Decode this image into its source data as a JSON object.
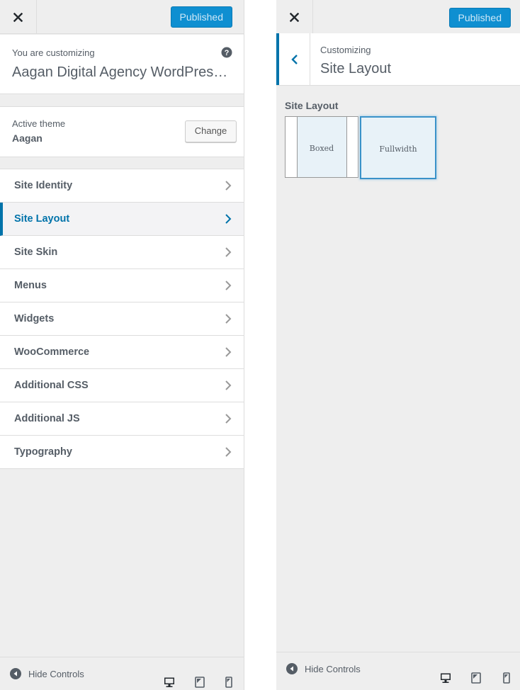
{
  "left": {
    "header": {
      "publish_label": "Published"
    },
    "customizing": {
      "label": "You are customizing",
      "site_title": "Aagan Digital Agency WordPress Theme"
    },
    "theme": {
      "label": "Active theme",
      "name": "Aagan",
      "change_label": "Change"
    },
    "menu": [
      {
        "label": "Site Identity",
        "active": false
      },
      {
        "label": "Site Layout",
        "active": true
      },
      {
        "label": "Site Skin",
        "active": false
      },
      {
        "label": "Menus",
        "active": false
      },
      {
        "label": "Widgets",
        "active": false
      },
      {
        "label": "WooCommerce",
        "active": false
      },
      {
        "label": "Additional CSS",
        "active": false
      },
      {
        "label": "Additional JS",
        "active": false
      },
      {
        "label": "Typography",
        "active": false
      }
    ],
    "footer": {
      "hide_label": "Hide Controls"
    }
  },
  "right": {
    "header": {
      "publish_label": "Published"
    },
    "section": {
      "breadcrumb": "Customizing",
      "title": "Site Layout"
    },
    "control": {
      "label": "Site Layout",
      "options": [
        {
          "label": "Boxed",
          "selected": false
        },
        {
          "label": "Fullwidth",
          "selected": true
        }
      ]
    },
    "footer": {
      "hide_label": "Hide Controls"
    }
  },
  "colors": {
    "accent": "#0073aa",
    "publish_button": "#0f8fd1",
    "panel_bg": "#eeeeee"
  },
  "icons": {
    "close": "close-icon",
    "help": "help-icon",
    "chevron": "chevron-right-icon",
    "back": "chevron-left-icon",
    "hide": "collapse-arrow-icon",
    "desktop": "desktop-icon",
    "tablet": "tablet-icon",
    "mobile": "mobile-icon"
  }
}
